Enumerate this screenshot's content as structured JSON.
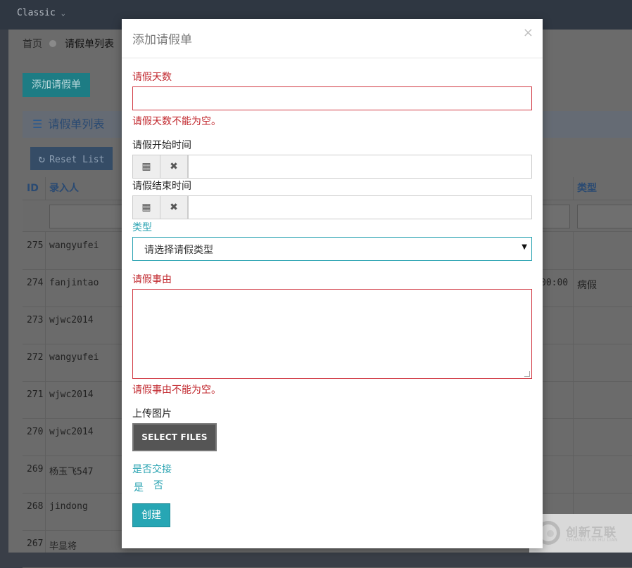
{
  "topbar": {
    "theme_label": "Classic",
    "chevron_icon": "chevron-down-icon"
  },
  "breadcrumb": {
    "home": "首页",
    "current": "请假单列表"
  },
  "page": {
    "add_button": "添加请假单",
    "panel_title": "请假单列表",
    "reset_button": "Reset List",
    "columns": [
      "ID",
      "录入人",
      "类型"
    ],
    "rows": [
      {
        "id": "275",
        "user": "wangyufei",
        "time": "",
        "type": ""
      },
      {
        "id": "274",
        "user": "fanjintao",
        "time": "00:00",
        "type": "病假"
      },
      {
        "id": "273",
        "user": "wjwc2014",
        "time": "",
        "type": ""
      },
      {
        "id": "272",
        "user": "wangyufei",
        "time": "",
        "type": ""
      },
      {
        "id": "271",
        "user": "wjwc2014",
        "time": "",
        "type": ""
      },
      {
        "id": "270",
        "user": "wjwc2014",
        "time": "",
        "type": ""
      },
      {
        "id": "269",
        "user": "杨玉飞547",
        "time": "",
        "type": ""
      },
      {
        "id": "268",
        "user": "jindong",
        "time": "",
        "type": ""
      },
      {
        "id": "267",
        "user": "毕显将",
        "time": "",
        "type": ""
      }
    ]
  },
  "modal": {
    "title": "添加请假单",
    "close": "×",
    "days_label": "请假天数",
    "days_value": "",
    "days_error": "请假天数不能为空。",
    "start_label": "请假开始时间",
    "start_value": "",
    "end_label": "请假结束时间",
    "end_value": "",
    "type_label": "类型",
    "type_selected": "请选择请假类型",
    "reason_label": "请假事由",
    "reason_value": "",
    "reason_error": "请假事由不能为空。",
    "upload_label": "上传图片",
    "select_files": "SELECT FILES",
    "handover_label": "是否交接",
    "radio_yes": "是",
    "radio_no": "否",
    "create_button": "创建"
  },
  "watermark": {
    "cn": "创新互联",
    "en": "CHUANG XIN HU LIAN"
  },
  "colors": {
    "error": "#c1272d",
    "accent": "#2aa3b2",
    "button": "#27a6b4"
  }
}
